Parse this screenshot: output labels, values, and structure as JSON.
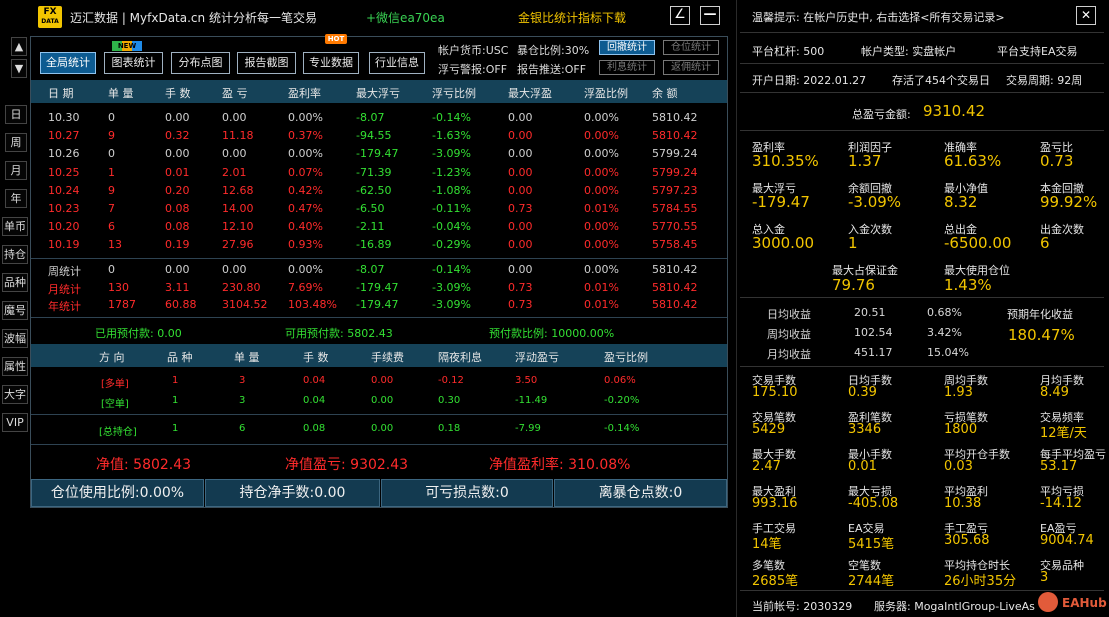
{
  "header": {
    "logo_top": "FX",
    "logo_bottom": "DATA",
    "title": "迈汇数据 | MyfxData.cn  统计分析每一笔交易",
    "wechat": "+微信ea70ea",
    "download": "金银比统计指标下载",
    "edit_glyph": "∠",
    "min_glyph": "—"
  },
  "side_nav": {
    "up": "▲",
    "down": "▼",
    "items": [
      "日",
      "周",
      "月",
      "年",
      "单币",
      "持仓",
      "品种",
      "魔号",
      "波幅",
      "属性",
      "大字",
      "VIP"
    ]
  },
  "toolbar": {
    "buttons": [
      "全局统计",
      "图表统计",
      "分布点图",
      "报告截图",
      "专业数据",
      "行业信息"
    ],
    "tag_new": "NEW",
    "tag_hot": "HOT",
    "info": {
      "currency": "帐户货币:USC",
      "exposure": "暴仓比例:30%",
      "float_alert": "浮亏警报:OFF",
      "report_push": "报告推送:OFF"
    },
    "small_buttons": [
      "回撤统计",
      "仓位统计",
      "利息统计",
      "返佣统计"
    ]
  },
  "stats_table": {
    "headers": [
      "日 期",
      "单 量",
      "手 数",
      "盈 亏",
      "盈利率",
      "最大浮亏",
      "浮亏比例",
      "最大浮盈",
      "浮盈比例",
      "余 额"
    ],
    "rows": [
      {
        "c": "w",
        "cells": [
          "10.30",
          "0",
          "0.00",
          "0.00",
          "0.00%",
          "-8.07",
          "-0.14%",
          "0.00",
          "0.00%",
          "5810.42"
        ]
      },
      {
        "c": "r",
        "cells": [
          "10.27",
          "9",
          "0.32",
          "11.18",
          "0.37%",
          "-94.55",
          "-1.63%",
          "0.00",
          "0.00%",
          "5810.42"
        ]
      },
      {
        "c": "w",
        "cells": [
          "10.26",
          "0",
          "0.00",
          "0.00",
          "0.00%",
          "-179.47",
          "-3.09%",
          "0.00",
          "0.00%",
          "5799.24"
        ]
      },
      {
        "c": "r",
        "cells": [
          "10.25",
          "1",
          "0.01",
          "2.01",
          "0.07%",
          "-71.39",
          "-1.23%",
          "0.00",
          "0.00%",
          "5799.24"
        ]
      },
      {
        "c": "r",
        "cells": [
          "10.24",
          "9",
          "0.20",
          "12.68",
          "0.42%",
          "-62.50",
          "-1.08%",
          "0.00",
          "0.00%",
          "5797.23"
        ]
      },
      {
        "c": "r",
        "cells": [
          "10.23",
          "7",
          "0.08",
          "14.00",
          "0.47%",
          "-6.50",
          "-0.11%",
          "0.73",
          "0.01%",
          "5784.55"
        ]
      },
      {
        "c": "r",
        "cells": [
          "10.20",
          "6",
          "0.08",
          "12.10",
          "0.40%",
          "-2.11",
          "-0.04%",
          "0.00",
          "0.00%",
          "5770.55"
        ]
      },
      {
        "c": "r",
        "cells": [
          "10.19",
          "13",
          "0.19",
          "27.96",
          "0.93%",
          "-16.89",
          "-0.29%",
          "0.00",
          "0.00%",
          "5758.45"
        ]
      }
    ],
    "summary_rows": [
      {
        "c": "w",
        "cells": [
          "周统计",
          "0",
          "0.00",
          "0.00",
          "0.00%",
          "-8.07",
          "-0.14%",
          "0.00",
          "0.00%",
          "5810.42"
        ]
      },
      {
        "c": "r",
        "cells": [
          "月统计",
          "130",
          "3.11",
          "230.80",
          "7.69%",
          "-179.47",
          "-3.09%",
          "0.73",
          "0.01%",
          "5810.42"
        ]
      },
      {
        "c": "r",
        "cells": [
          "年统计",
          "1787",
          "60.88",
          "3104.52",
          "103.48%",
          "-179.47",
          "-3.09%",
          "0.73",
          "0.01%",
          "5810.42"
        ]
      }
    ]
  },
  "prepay": {
    "used": "已用预付款:  0.00",
    "available": "可用预付款:  5802.43",
    "ratio": "预付款比例:  10000.00%"
  },
  "positions": {
    "headers": [
      "方 向",
      "品 种",
      "单 量",
      "手 数",
      "手续费",
      "隔夜利息",
      "浮动盈亏",
      "盈亏比例"
    ],
    "rows": [
      {
        "cells": [
          "[多单]",
          "1",
          "3",
          "0.04",
          "0.00",
          "-0.12",
          "3.50",
          "0.06%"
        ],
        "c": "r"
      },
      {
        "cells": [
          "[空单]",
          "1",
          "3",
          "0.04",
          "0.00",
          "0.30",
          "-11.49",
          "-0.20%"
        ],
        "c": "g"
      }
    ],
    "total": {
      "cells": [
        "[总持仓]",
        "1",
        "6",
        "0.08",
        "0.00",
        "0.18",
        "-7.99",
        "-0.14%"
      ],
      "c": "g"
    }
  },
  "net": {
    "net_value": "净值:  5802.43",
    "net_pl": "净值盈亏:  9302.43",
    "net_rate": "净值盈利率:  310.08%"
  },
  "bottom_buttons": [
    "仓位使用比例:0.00%",
    "持仓净手数:0.00",
    "可亏损点数:0",
    "离暴仓点数:0"
  ],
  "right": {
    "hint": "温馨提示: 在帐户历史中, 右击选择<所有交易记录>",
    "close_glyph": "✕",
    "leverage": "平台杠杆:  500",
    "account_type": "帐户类型:  实盘帐户",
    "ea_support": "平台支持EA交易",
    "open_date": "开户日期:  2022.01.27",
    "survival": "存活了454个交易日",
    "period": "交易周期:  92周",
    "total_pl_label": "总盈亏金额:",
    "total_pl_value": "9310.42",
    "grid1": [
      {
        "label": "盈利率",
        "value": "310.35%"
      },
      {
        "label": "利润因子",
        "value": "1.37"
      },
      {
        "label": "准确率",
        "value": "61.63%"
      },
      {
        "label": "盈亏比",
        "value": "0.73"
      },
      {
        "label": "最大浮亏",
        "value": "-179.47"
      },
      {
        "label": "余额回撤",
        "value": "-3.09%"
      },
      {
        "label": "最小净值",
        "value": "8.32"
      },
      {
        "label": "本金回撤",
        "value": "99.92%"
      },
      {
        "label": "总入金",
        "value": "3000.00"
      },
      {
        "label": "入金次数",
        "value": "1"
      },
      {
        "label": "总出金",
        "value": "-6500.00"
      },
      {
        "label": "出金次数",
        "value": "6"
      }
    ],
    "margin": [
      {
        "label": "最大占保证金",
        "value": "79.76"
      },
      {
        "label": "最大使用仓位",
        "value": "1.43%"
      }
    ],
    "avg": [
      {
        "label": "日均收益",
        "value": "20.51",
        "pct": "0.68%"
      },
      {
        "label": "周均收益",
        "value": "102.54",
        "pct": "3.42%"
      },
      {
        "label": "月均收益",
        "value": "451.17",
        "pct": "15.04%"
      }
    ],
    "annual_label": "预期年化收益",
    "annual_value": "180.47%",
    "grid2": [
      {
        "label": "交易手数",
        "value": "175.10"
      },
      {
        "label": "日均手数",
        "value": "0.39"
      },
      {
        "label": "周均手数",
        "value": "1.93"
      },
      {
        "label": "月均手数",
        "value": "8.49"
      },
      {
        "label": "交易笔数",
        "value": "5429"
      },
      {
        "label": "盈利笔数",
        "value": "3346"
      },
      {
        "label": "亏损笔数",
        "value": "1800"
      },
      {
        "label": "交易频率",
        "value": "12笔/天"
      },
      {
        "label": "最大手数",
        "value": "2.47"
      },
      {
        "label": "最小手数",
        "value": "0.01"
      },
      {
        "label": "平均开仓手数",
        "value": "0.03"
      },
      {
        "label": "每手平均盈亏",
        "value": "53.17"
      },
      {
        "label": "最大盈利",
        "value": "993.16"
      },
      {
        "label": "最大亏损",
        "value": "-405.08"
      },
      {
        "label": "平均盈利",
        "value": "10.38"
      },
      {
        "label": "平均亏损",
        "value": "-14.12"
      },
      {
        "label": "手工交易",
        "value": "14笔"
      },
      {
        "label": "EA交易",
        "value": "5415笔"
      },
      {
        "label": "手工盈亏",
        "value": "305.68"
      },
      {
        "label": "EA盈亏",
        "value": "9004.74"
      },
      {
        "label": "多笔数",
        "value": "2685笔"
      },
      {
        "label": "空笔数",
        "value": "2744笔"
      },
      {
        "label": "平均持仓时长",
        "value": "26小时35分"
      },
      {
        "label": "交易品种",
        "value": "3"
      }
    ],
    "account_no": "当前帐号:  2030329",
    "server": "服务器:  MogaIntlGroup-LiveAs",
    "watermark": "EAHub"
  },
  "colors": {
    "accent": "#f2c500",
    "loss": "#ff2b2b",
    "gain": "#33e033",
    "header_bg": "#154258"
  }
}
